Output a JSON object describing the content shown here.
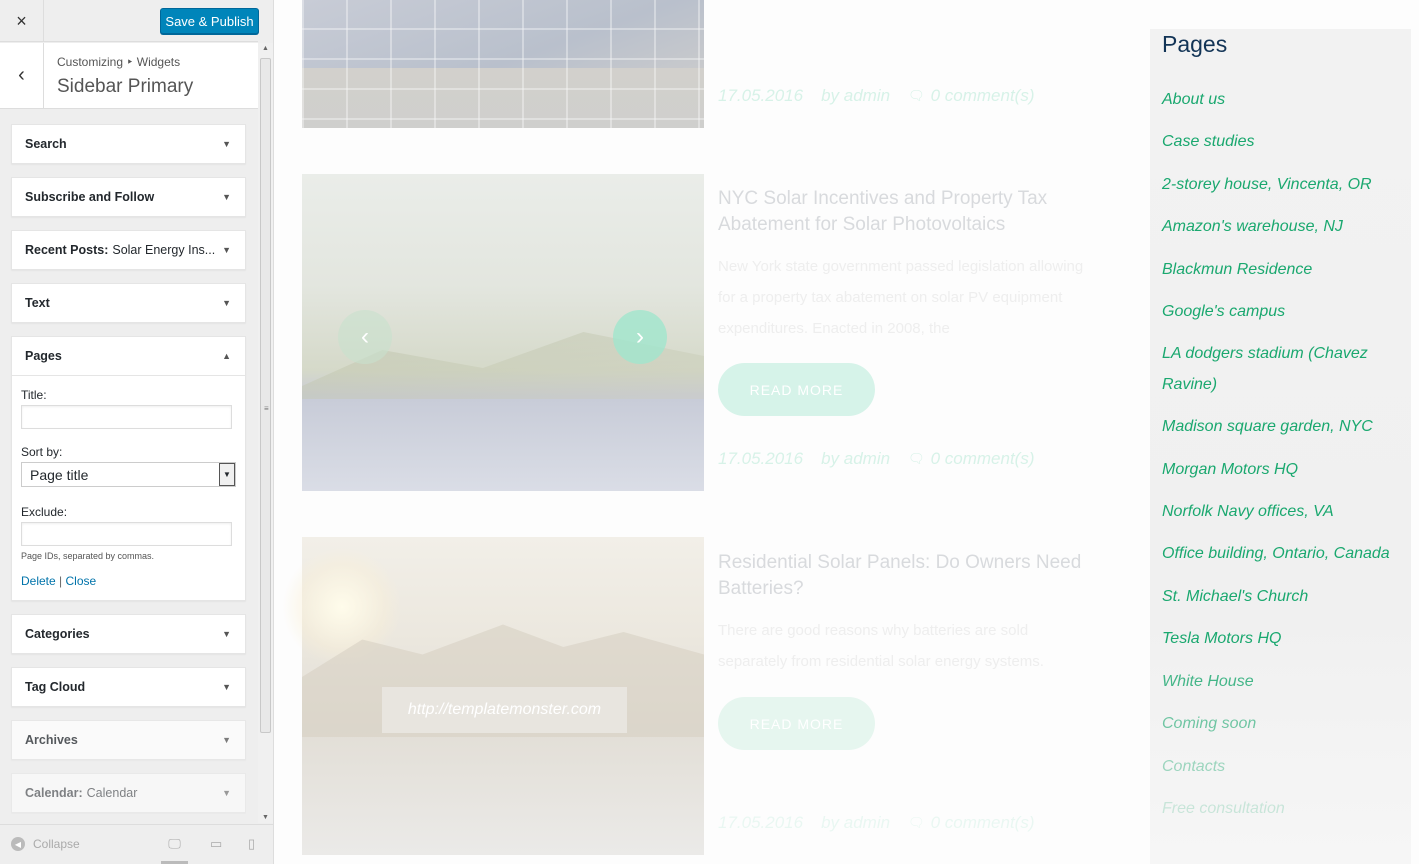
{
  "customizer": {
    "close_label": "×",
    "save_label": "Save & Publish",
    "back_label": "‹",
    "breadcrumb": "Customizing ‣ Widgets",
    "section_title": "Sidebar Primary",
    "widgets": [
      {
        "title": "Search",
        "sub": ""
      },
      {
        "title": "Subscribe and Follow",
        "sub": ""
      },
      {
        "title": "Recent Posts:",
        "sub": "Solar Energy Ins..."
      },
      {
        "title": "Text",
        "sub": ""
      },
      {
        "title": "Pages",
        "sub": "",
        "expanded": true
      },
      {
        "title": "Categories",
        "sub": ""
      },
      {
        "title": "Tag Cloud",
        "sub": ""
      },
      {
        "title": "Archives",
        "sub": ""
      },
      {
        "title": "Calendar:",
        "sub": "Calendar"
      }
    ],
    "pages_form": {
      "title_label": "Title:",
      "title_value": "",
      "sort_label": "Sort by:",
      "sort_value": "Page title",
      "exclude_label": "Exclude:",
      "exclude_value": "",
      "exclude_desc": "Page IDs, separated by commas.",
      "delete_label": "Delete",
      "separator": "|",
      "close_label": "Close"
    },
    "footer": {
      "collapse_label": "Collapse"
    }
  },
  "preview": {
    "posts": [
      {
        "date": "17.05.2016",
        "author": "by admin",
        "comments": "0 comment(s)"
      },
      {
        "title": "NYC Solar Incentives and Property Tax Abatement for Solar Photovoltaics",
        "excerpt": "New York state government passed legislation allowing for a property tax abatement on solar PV equipment expenditures. Enacted in 2008, the",
        "read_more": "READ MORE",
        "date": "17.05.2016",
        "author": "by admin",
        "comments": "0 comment(s)"
      },
      {
        "title": "Residential Solar Panels: Do Owners Need Batteries?",
        "excerpt": "There are good reasons why batteries are sold separately from residential solar energy systems.",
        "read_more": "READ MORE",
        "date": "17.05.2016",
        "author": "by admin",
        "comments": "0 comment(s)",
        "watermark": "http://templatemonster.com"
      }
    ],
    "sidebar": {
      "title": "Pages",
      "items": [
        "About us",
        "Case studies",
        "2-storey house, Vincenta, OR",
        "Amazon's warehouse, NJ",
        "Blackmun Residence",
        "Google's campus",
        "LA dodgers stadium (Chavez Ravine)",
        "Madison square garden, NYC",
        "Morgan Motors HQ",
        "Norfolk Navy offices, VA",
        "Office building, Ontario, Canada",
        "St. Michael's Church",
        "Tesla Motors HQ",
        "White House",
        "Coming soon",
        "Contacts",
        "Free consultation"
      ]
    }
  },
  "colors": {
    "accent": "#0085ba",
    "link_green": "#1aa86f",
    "sidebar_title": "#123456"
  }
}
